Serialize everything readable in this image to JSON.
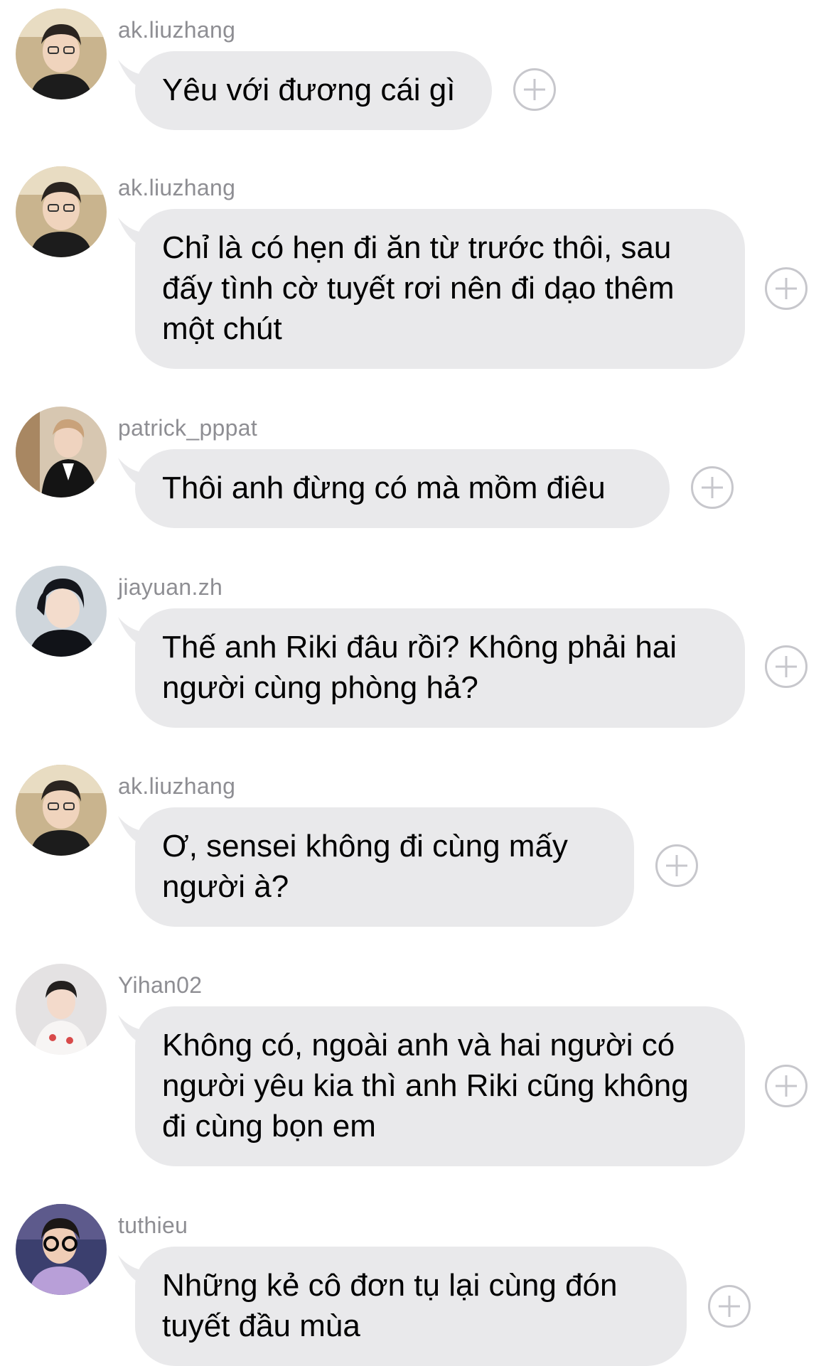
{
  "messages": [
    {
      "username": "ak.liuzhang",
      "avatar": "avatar-ak-liuzhang",
      "text": "Yêu với đương cái gì"
    },
    {
      "username": "ak.liuzhang",
      "avatar": "avatar-ak-liuzhang",
      "text": "Chỉ là có hẹn đi ăn từ trước thôi, sau đấy tình cờ tuyết rơi nên đi dạo thêm một chút"
    },
    {
      "username": "patrick_pppat",
      "avatar": "avatar-patrick-pppat",
      "text": "Thôi anh đừng có mà mồm điêu"
    },
    {
      "username": "jiayuan.zh",
      "avatar": "avatar-jiayuan-zh",
      "text": "Thế anh Riki đâu rồi? Không phải hai người cùng phòng hả?"
    },
    {
      "username": "ak.liuzhang",
      "avatar": "avatar-ak-liuzhang",
      "text": "Ơ, sensei không đi cùng mấy người à?"
    },
    {
      "username": "Yihan02",
      "avatar": "avatar-yihan02",
      "text": "Không có, ngoài anh và hai người có người yêu kia thì anh Riki cũng không đi cùng bọn em"
    },
    {
      "username": "tuthieu",
      "avatar": "avatar-tuthieu",
      "text": "Những kẻ cô đơn tụ lại cùng đón tuyết đầu mùa"
    }
  ],
  "icons": {
    "add_reaction": "plus-circle-icon"
  },
  "colors": {
    "bubble": "#e9e9eb",
    "username": "#8e8e93",
    "icon": "#c7c7cc",
    "text": "#000000"
  }
}
